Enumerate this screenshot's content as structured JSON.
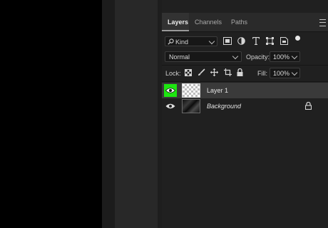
{
  "tabs": [
    {
      "label": "Layers",
      "active": true
    },
    {
      "label": "Channels",
      "active": false
    },
    {
      "label": "Paths",
      "active": false
    }
  ],
  "panel_menu_icon": "hamburger-menu-icon",
  "filter": {
    "search_icon": "magnifier-icon",
    "kind_label": "Kind",
    "filter_icons": [
      "image-filter-icon",
      "adjustment-filter-icon",
      "type-filter-icon",
      "shape-filter-icon",
      "smart-object-filter-icon"
    ],
    "toggle_icon": "filter-toggle-dot-icon"
  },
  "blend": {
    "mode": "Normal",
    "opacity_label": "Opacity:",
    "opacity_value": "100%"
  },
  "lock": {
    "label": "Lock:",
    "icons": [
      "lock-transparent-pixels-icon",
      "lock-image-pixels-icon",
      "lock-position-icon",
      "lock-artboard-icon",
      "lock-all-icon"
    ],
    "fill_label": "Fill:",
    "fill_value": "100%"
  },
  "layers": [
    {
      "name": "Layer 1",
      "visible": true,
      "selected": true,
      "eye_highlight": "#1de510",
      "thumbnail": "transparent-checkerboard"
    },
    {
      "name": "Background",
      "visible": true,
      "selected": false,
      "locked": true,
      "thumbnail": "dark-image"
    }
  ],
  "colors": {
    "highlight": "#1de510",
    "panel_bg": "#202020",
    "selected_row": "#3a3a3a"
  }
}
